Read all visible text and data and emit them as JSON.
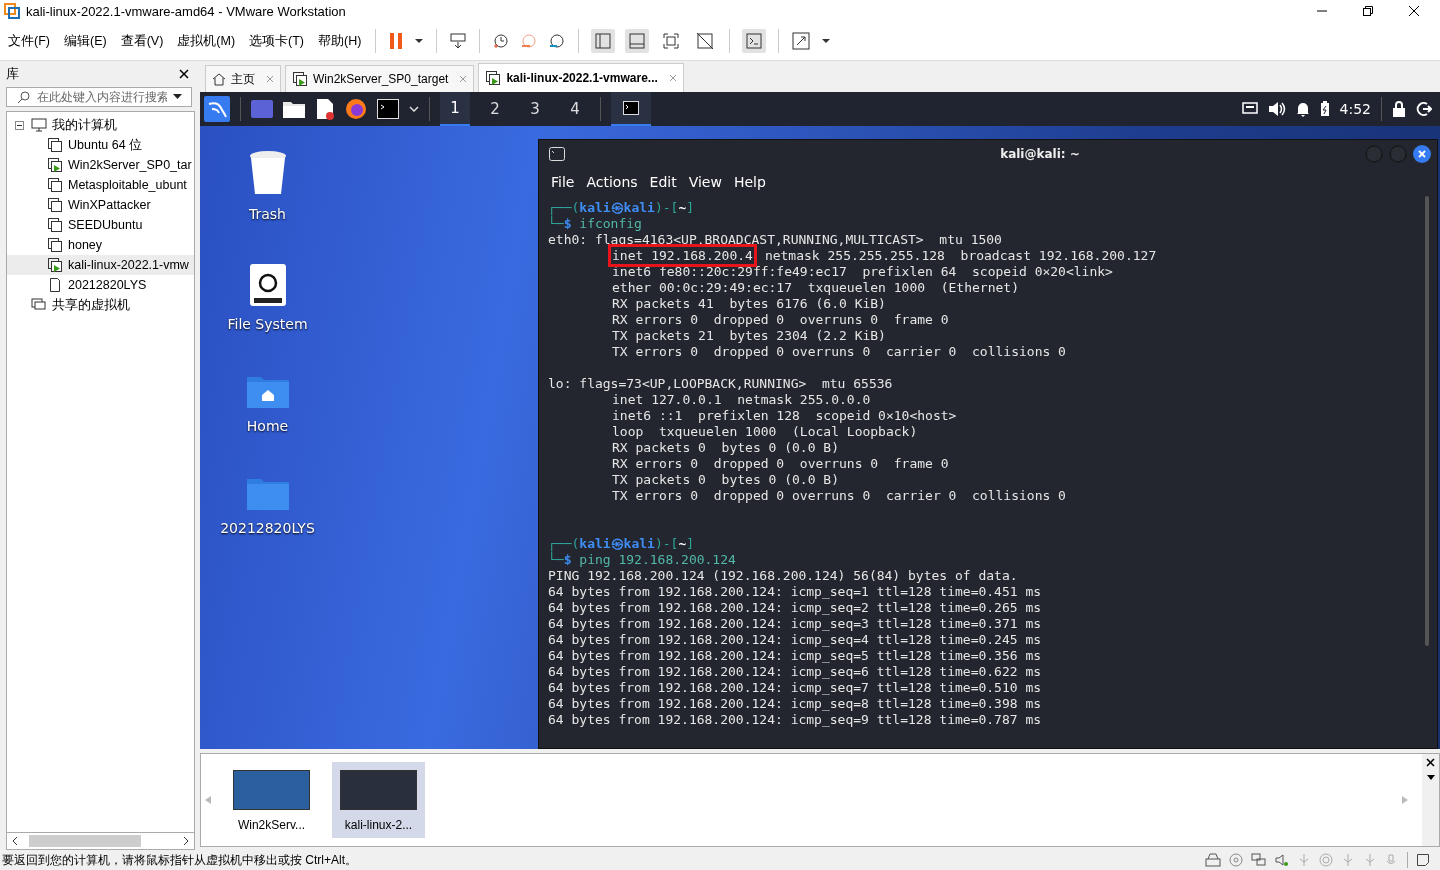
{
  "window": {
    "title": "kali-linux-2022.1-vmware-amd64 - VMware Workstation"
  },
  "menu": [
    "文件(F)",
    "编辑(E)",
    "查看(V)",
    "虚拟机(M)",
    "选项卡(T)",
    "帮助(H)"
  ],
  "library": {
    "title": "库",
    "search": {
      "placeholder": "在此处键入内容进行搜索"
    },
    "tree": [
      {
        "label": "我的计算机",
        "kind": "computer",
        "expanded": true,
        "children": [
          {
            "label": "Ubuntu 64 位",
            "kind": "vm",
            "running": false,
            "selected": false
          },
          {
            "label": "Win2kServer_SP0_tar",
            "kind": "vm",
            "running": true,
            "selected": false
          },
          {
            "label": "Metasploitable_ubunt",
            "kind": "vm",
            "running": false,
            "selected": false
          },
          {
            "label": "WinXPattacker",
            "kind": "vm",
            "running": false,
            "selected": false
          },
          {
            "label": "SEEDUbuntu",
            "kind": "vm",
            "running": false,
            "selected": false
          },
          {
            "label": "honey",
            "kind": "vm",
            "running": false,
            "selected": false
          },
          {
            "label": "kali-linux-2022.1-vmw",
            "kind": "vm",
            "running": true,
            "selected": true
          },
          {
            "label": "20212820LYS",
            "kind": "team",
            "selected": false
          }
        ]
      },
      {
        "label": "共享的虚拟机",
        "kind": "shared"
      }
    ]
  },
  "tabs": [
    {
      "label": "主页",
      "kind": "home",
      "selected": false
    },
    {
      "label": "Win2kServer_SP0_target",
      "kind": "vm",
      "selected": false
    },
    {
      "label": "kali-linux-2022.1-vmware...",
      "kind": "vm",
      "selected": true
    }
  ],
  "guest": {
    "panel": {
      "workspaces": [
        {
          "label": "1",
          "selected": true
        },
        {
          "label": "2",
          "selected": false
        },
        {
          "label": "3",
          "selected": false
        },
        {
          "label": "4",
          "selected": false
        }
      ],
      "clock": "4:52"
    },
    "desktop_icons": [
      {
        "label": "Trash",
        "kind": "trash"
      },
      {
        "label": "File System",
        "kind": "drive"
      },
      {
        "label": "Home",
        "kind": "home"
      },
      {
        "label": "20212820LYS",
        "kind": "folder"
      }
    ],
    "terminal": {
      "title": "kali@kali: ~",
      "menu": [
        "File",
        "Actions",
        "Edit",
        "View",
        "Help"
      ],
      "lines": [
        {
          "kind": "prompt",
          "corner": "┌──(",
          "user": "kali㉿kali",
          "mid": ")-[",
          "dir": "~",
          "end": "]"
        },
        {
          "kind": "command",
          "corner": "└─",
          "sigil": "$",
          "command": "ifconfig"
        },
        {
          "kind": "output",
          "text": "eth0: flags=4163<UP,BROADCAST,RUNNING,MULTICAST>  mtu 1500"
        },
        {
          "kind": "marked",
          "marked": "inet 192.168.200.4",
          "text": "netmask 255.255.255.128  broadcast 192.168.200.127"
        },
        {
          "kind": "indented",
          "text": "inet6 fe80::20c:29ff:fe49:ec17  prefixlen 64  scopeid 0×20<link>"
        },
        {
          "kind": "indented",
          "text": "ether 00:0c:29:49:ec:17  txqueuelen 1000  (Ethernet)"
        },
        {
          "kind": "indented",
          "text": "RX packets 41  bytes 6176 (6.0 KiB)"
        },
        {
          "kind": "indented",
          "text": "RX errors 0  dropped 0  overruns 0  frame 0"
        },
        {
          "kind": "indented",
          "text": "TX packets 21  bytes 2304 (2.2 KiB)"
        },
        {
          "kind": "indented",
          "text": "TX errors 0  dropped 0 overruns 0  carrier 0  collisions 0"
        },
        {
          "kind": "blank"
        },
        {
          "kind": "output",
          "text": "lo: flags=73<UP,LOOPBACK,RUNNING>  mtu 65536"
        },
        {
          "kind": "indented",
          "text": "inet 127.0.0.1  netmask 255.0.0.0"
        },
        {
          "kind": "indented",
          "text": "inet6 ::1  prefixlen 128  scopeid 0×10<host>"
        },
        {
          "kind": "indented",
          "text": "loop  txqueuelen 1000  (Local Loopback)"
        },
        {
          "kind": "indented",
          "text": "RX packets 0  bytes 0 (0.0 B)"
        },
        {
          "kind": "indented",
          "text": "RX errors 0  dropped 0  overruns 0  frame 0"
        },
        {
          "kind": "indented",
          "text": "TX packets 0  bytes 0 (0.0 B)"
        },
        {
          "kind": "indented",
          "text": "TX errors 0  dropped 0 overruns 0  carrier 0  collisions 0"
        },
        {
          "kind": "blank"
        },
        {
          "kind": "blank"
        },
        {
          "kind": "prompt",
          "corner": "┌──(",
          "user": "kali㉿kali",
          "mid": ")-[",
          "dir": "~",
          "end": "]"
        },
        {
          "kind": "command",
          "corner": "└─",
          "sigil": "$",
          "command": "ping 192.168.200.124"
        },
        {
          "kind": "output",
          "text": "PING 192.168.200.124 (192.168.200.124) 56(84) bytes of data."
        },
        {
          "kind": "output",
          "text": "64 bytes from 192.168.200.124: icmp_seq=1 ttl=128 time=0.451 ms"
        },
        {
          "kind": "output",
          "text": "64 bytes from 192.168.200.124: icmp_seq=2 ttl=128 time=0.265 ms"
        },
        {
          "kind": "output",
          "text": "64 bytes from 192.168.200.124: icmp_seq=3 ttl=128 time=0.371 ms"
        },
        {
          "kind": "output",
          "text": "64 bytes from 192.168.200.124: icmp_seq=4 ttl=128 time=0.245 ms"
        },
        {
          "kind": "output",
          "text": "64 bytes from 192.168.200.124: icmp_seq=5 ttl=128 time=0.356 ms"
        },
        {
          "kind": "output",
          "text": "64 bytes from 192.168.200.124: icmp_seq=6 ttl=128 time=0.622 ms"
        },
        {
          "kind": "output",
          "text": "64 bytes from 192.168.200.124: icmp_seq=7 ttl=128 time=0.510 ms"
        },
        {
          "kind": "output",
          "text": "64 bytes from 192.168.200.124: icmp_seq=8 ttl=128 time=0.398 ms"
        },
        {
          "kind": "output",
          "text": "64 bytes from 192.168.200.124: icmp_seq=9 ttl=128 time=0.787 ms"
        }
      ]
    }
  },
  "thumbnails": [
    {
      "label": "Win2kServ...",
      "selected": false
    },
    {
      "label": "kali-linux-2...",
      "selected": true
    }
  ],
  "status_bar": {
    "message": "要返回到您的计算机，请将鼠标指针从虚拟机中移出或按 Ctrl+Alt。"
  }
}
